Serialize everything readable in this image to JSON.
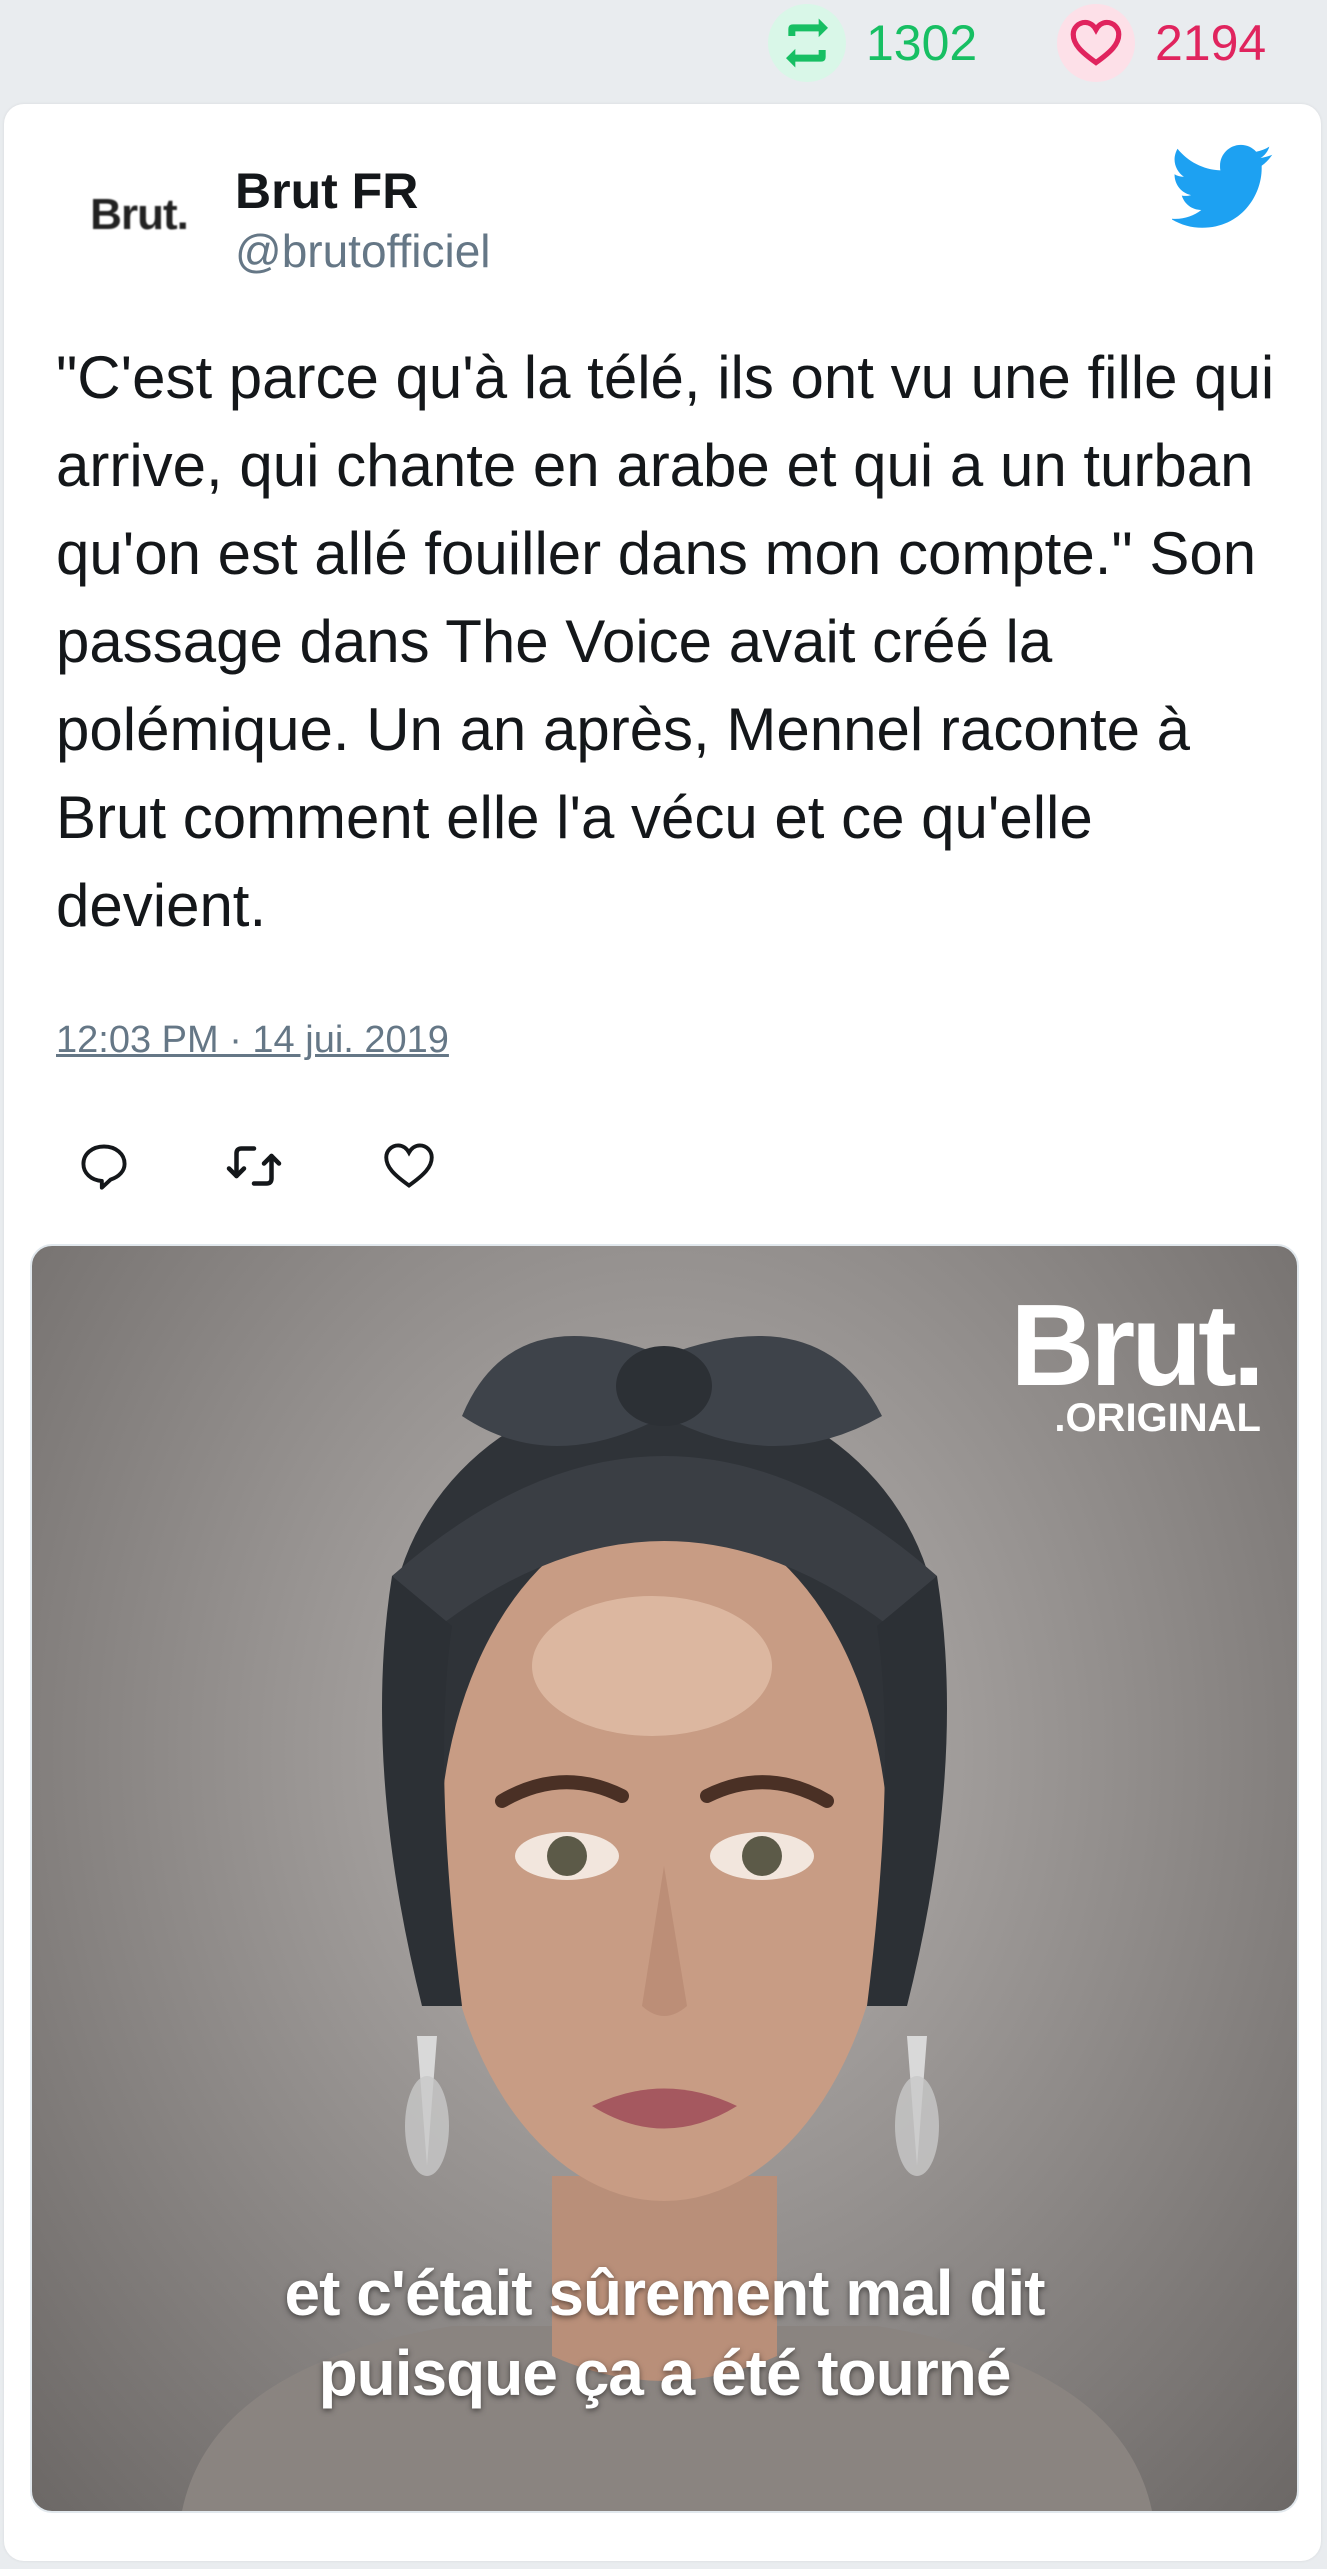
{
  "stats": {
    "retweets": "1302",
    "likes": "2194"
  },
  "tweet": {
    "avatar_text": "Brut.",
    "author_name": "Brut FR",
    "author_handle": "@brutofficiel",
    "text": "\"C'est parce qu'à la télé, ils ont vu une fille qui arrive, qui chante en arabe et qui a un turban qu'on est allé fouiller dans mon compte.\" Son passage dans The Voice avait créé la polémique. Un an après, Mennel raconte à Brut comment elle l'a vécu et ce qu'elle devient.",
    "timestamp": "12:03 PM · 14 jui. 2019"
  },
  "media": {
    "brand_main": "Brut.",
    "brand_sub": ".ORIGINAL",
    "subtitle_line1": "et c'était sûrement mal dit",
    "subtitle_line2": "puisque ça a été tourné"
  },
  "icons": {
    "retweet": "retweet-icon",
    "like": "heart-icon",
    "reply": "reply-icon",
    "twitter": "twitter-bird-icon"
  },
  "colors": {
    "retweet": "#17bf63",
    "like": "#e0245e",
    "twitter_blue": "#1da1f2",
    "secondary_text": "#657786"
  }
}
